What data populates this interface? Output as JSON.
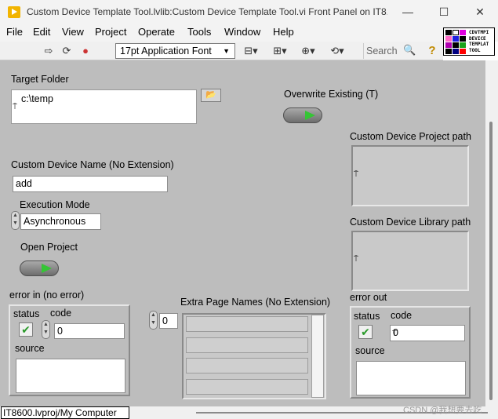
{
  "window": {
    "title": "Custom Device Template Tool.lvlib:Custom Device Template Tool.vi Front Panel on IT8...",
    "controls": {
      "minimize": "—",
      "maximize": "☐",
      "close": "✕"
    }
  },
  "menu": [
    "File",
    "Edit",
    "View",
    "Project",
    "Operate",
    "Tools",
    "Window",
    "Help"
  ],
  "toolbar": {
    "run": "⇨",
    "run_continuously": "⟳",
    "abort": "●",
    "font": "17pt Application Font",
    "font_arrow": "▼",
    "align": "⊟▾",
    "distribute": "⊞▾",
    "resize": "⊕▾",
    "reorder": "⟲▾",
    "search_placeholder": "Search",
    "search_icon": "🔍",
    "help": "?"
  },
  "vi_icon": {
    "text": "CDVTMPI DEVICE TEMPLAT TOOL"
  },
  "panel": {
    "target_folder": {
      "label": "Target Folder",
      "value": "c:\\temp",
      "browse": "📂"
    },
    "overwrite": {
      "label": "Overwrite Existing (T)",
      "value": true
    },
    "device_name": {
      "label": "Custom Device Name (No Extension)",
      "value": "add"
    },
    "execution_mode": {
      "label": "Execution Mode",
      "value": "Asynchronous"
    },
    "open_project": {
      "label": "Open Project",
      "value": true
    },
    "project_path": {
      "label": "Custom Device Project path"
    },
    "library_path": {
      "label": "Custom Device Library path"
    },
    "error_in": {
      "label": "error in (no error)",
      "status_label": "status",
      "code_label": "code",
      "code_value": "0",
      "source_label": "source"
    },
    "extra_pages": {
      "label": "Extra Page Names (No Extension)",
      "index": "0"
    },
    "error_out": {
      "label": "error out",
      "status_label": "status",
      "code_label": "code",
      "code_value": "0",
      "source_label": "source"
    }
  },
  "status_bar": {
    "path": "IT8600.lvproj/My Computer"
  },
  "watermark": "CSDN @我想要去吃"
}
